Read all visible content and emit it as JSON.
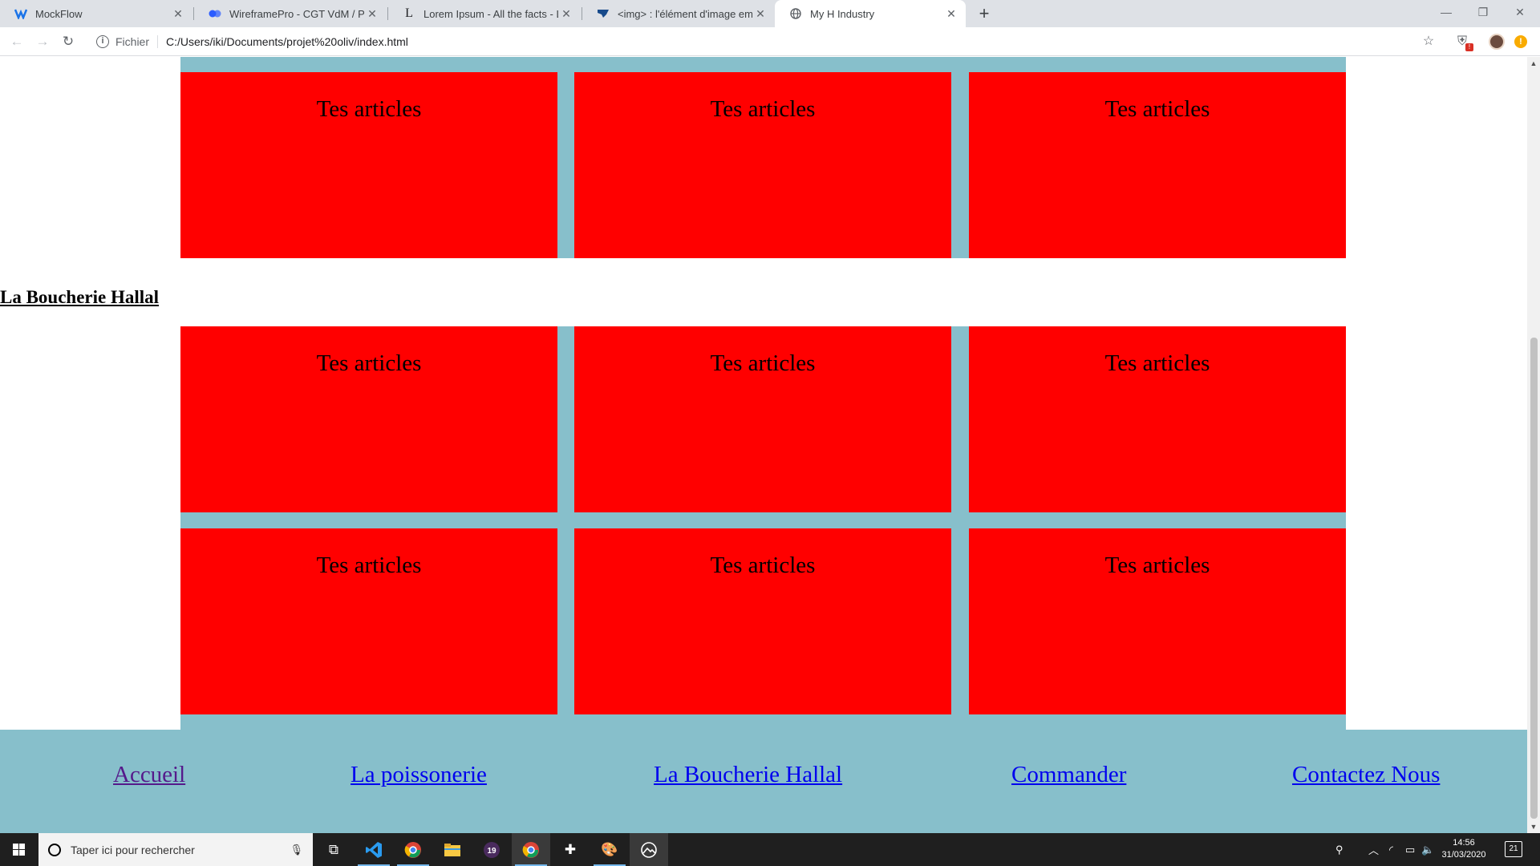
{
  "browser": {
    "tabs": [
      {
        "title": "MockFlow",
        "icon": "mockflow-icon"
      },
      {
        "title": "WireframePro - CGT VdM / Page",
        "icon": "wireframepro-icon"
      },
      {
        "title": "Lorem Ipsum - All the facts - Lips",
        "icon": "lipsum-icon"
      },
      {
        "title": "<img> : l'élément d'image emba",
        "icon": "mdn-icon"
      },
      {
        "title": "My H Industry",
        "icon": "globe-icon",
        "active": true
      }
    ],
    "new_tab_label": "+",
    "address": {
      "scheme_label": "Fichier",
      "url": "C:/Users/iki/Documents/projet%20oliv/index.html"
    }
  },
  "page": {
    "card_label": "Tes articles",
    "top_grid": [
      "Tes articles",
      "Tes articles",
      "Tes articles"
    ],
    "section_title": "La Boucherie Hallal",
    "bottom_grid": [
      "Tes articles",
      "Tes articles",
      "Tes articles",
      "Tes articles",
      "Tes articles",
      "Tes articles"
    ],
    "footer_links": [
      {
        "label": "Accueil",
        "visited": true
      },
      {
        "label": "La poissonerie",
        "visited": false
      },
      {
        "label": "La Boucherie Hallal",
        "visited": false
      },
      {
        "label": "Commander",
        "visited": false
      },
      {
        "label": "Contactez Nous",
        "visited": false
      }
    ],
    "colors": {
      "card": "#ff0000",
      "grid_background": "#87bfcb",
      "footer": "#87bfcb",
      "link": "#0000ee",
      "visited_link": "#551a8b"
    }
  },
  "taskbar": {
    "search_placeholder": "Taper ici pour rechercher",
    "apps": [
      "task-view-icon",
      "vscode-icon",
      "chrome-icon",
      "file-explorer-icon",
      "app-19-icon",
      "chrome-profile-icon",
      "plus-app-icon",
      "paint-icon",
      "photos-icon"
    ],
    "clock_time": "14:56",
    "clock_date": "31/03/2020",
    "notification_count": "21"
  }
}
